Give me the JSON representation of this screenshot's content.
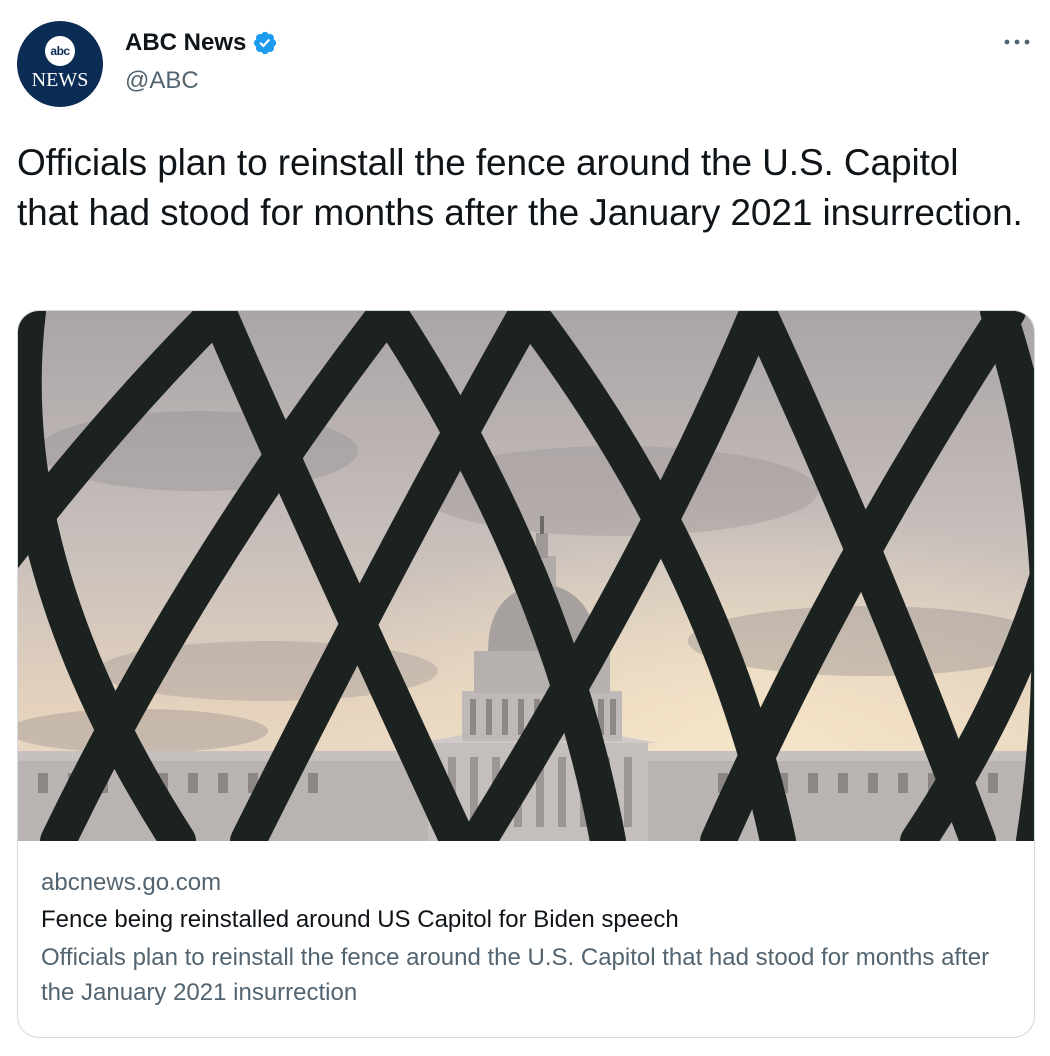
{
  "author": {
    "name": "ABC News",
    "handle": "@ABC",
    "verified": true,
    "avatar_badge": "abc",
    "avatar_text": "NEWS"
  },
  "tweet": {
    "text": "Officials plan to reinstall the fence around the U.S. Capitol that had stood for months after the January 2021 insurrection."
  },
  "card": {
    "domain": "abcnews.go.com",
    "title": "Fence being reinstalled around US Capitol for Biden speech",
    "description": "Officials plan to reinstall the fence around the U.S. Capitol that had stood for months after the January 2021 insurrection"
  },
  "icons": {
    "verified": "verified-badge-icon",
    "more": "more-options-icon"
  },
  "colors": {
    "verified_blue": "#1d9bf0",
    "secondary_text": "#536471",
    "brand_navy": "#0b2d55"
  }
}
